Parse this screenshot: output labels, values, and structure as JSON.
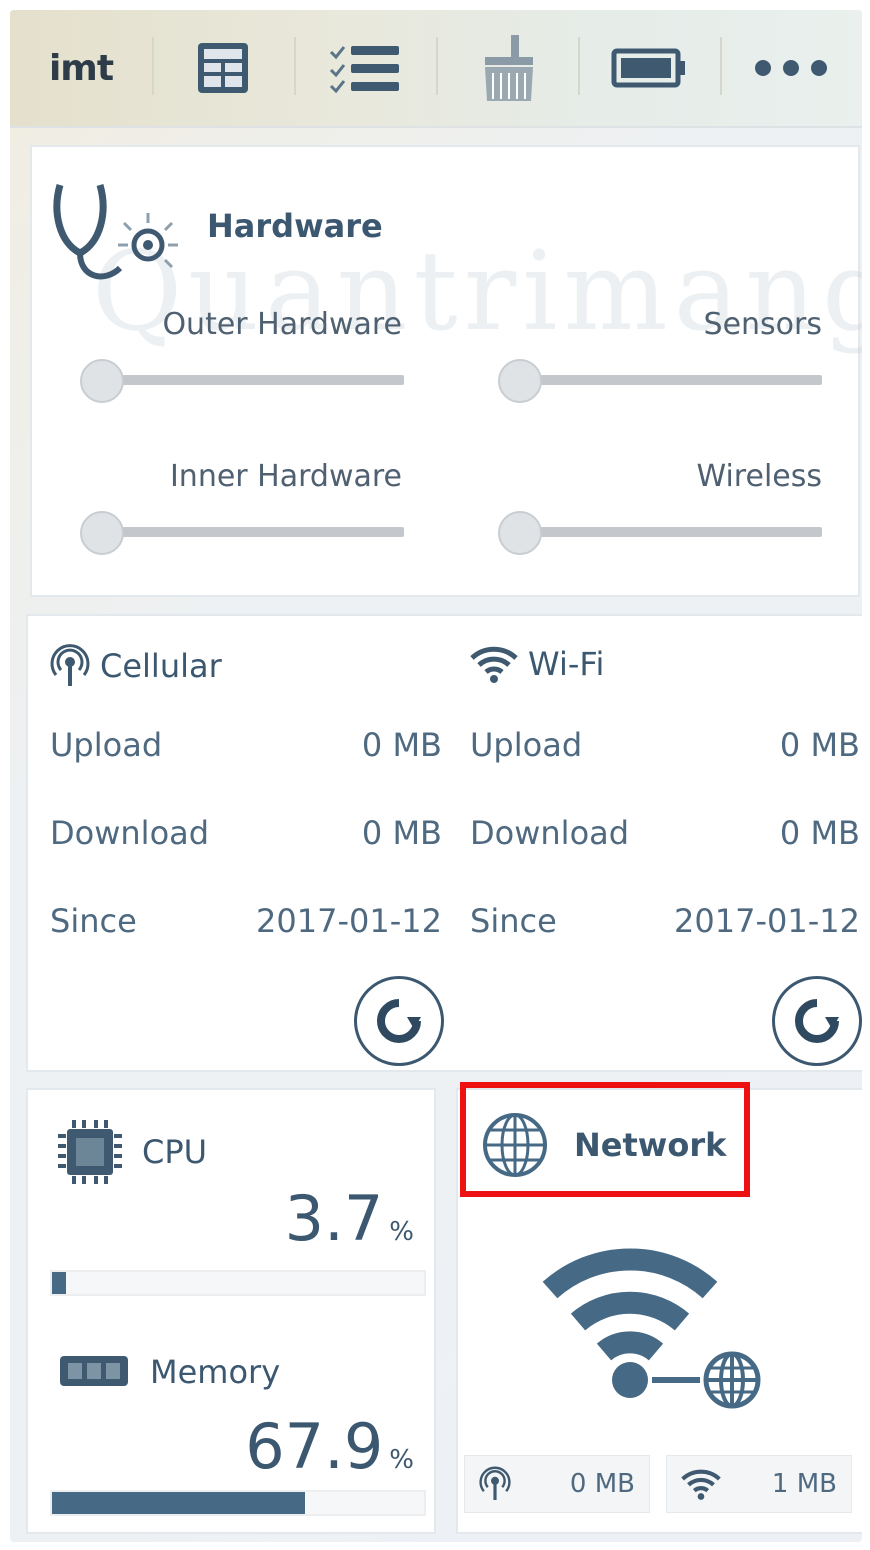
{
  "toolbar": {
    "logo": "imt",
    "items": [
      {
        "icon": "dashboard-icon"
      },
      {
        "icon": "checklist-icon"
      },
      {
        "icon": "broom-icon"
      },
      {
        "icon": "battery-icon"
      },
      {
        "icon": "more-dots-icon"
      }
    ]
  },
  "hardware": {
    "title": "Hardware",
    "watermark": "Quantrimang",
    "sliders": [
      {
        "label": "Outer Hardware",
        "value": 0
      },
      {
        "label": "Sensors",
        "value": 0
      },
      {
        "label": "Inner Hardware",
        "value": 0
      },
      {
        "label": "Wireless",
        "value": 0
      }
    ]
  },
  "cellular": {
    "title": "Cellular",
    "upload_label": "Upload",
    "upload_value": "0 MB",
    "download_label": "Download",
    "download_value": "0 MB",
    "since_label": "Since",
    "since_value": "2017-01-12"
  },
  "wifi": {
    "title": "Wi-Fi",
    "upload_label": "Upload",
    "upload_value": "0 MB",
    "download_label": "Download",
    "download_value": "0 MB",
    "since_label": "Since",
    "since_value": "2017-01-12"
  },
  "cpu": {
    "title": "CPU",
    "value": "3.7",
    "unit": "%",
    "fraction": 0.037
  },
  "memory": {
    "title": "Memory",
    "value": "67.9",
    "unit": "%",
    "fraction": 0.679
  },
  "network": {
    "title": "Network",
    "cellular_usage": "0 MB",
    "wifi_usage": "1 MB"
  },
  "colors": {
    "accent": "#3c5870",
    "highlight": "#ee1111",
    "bar_fill": "#466a85"
  }
}
